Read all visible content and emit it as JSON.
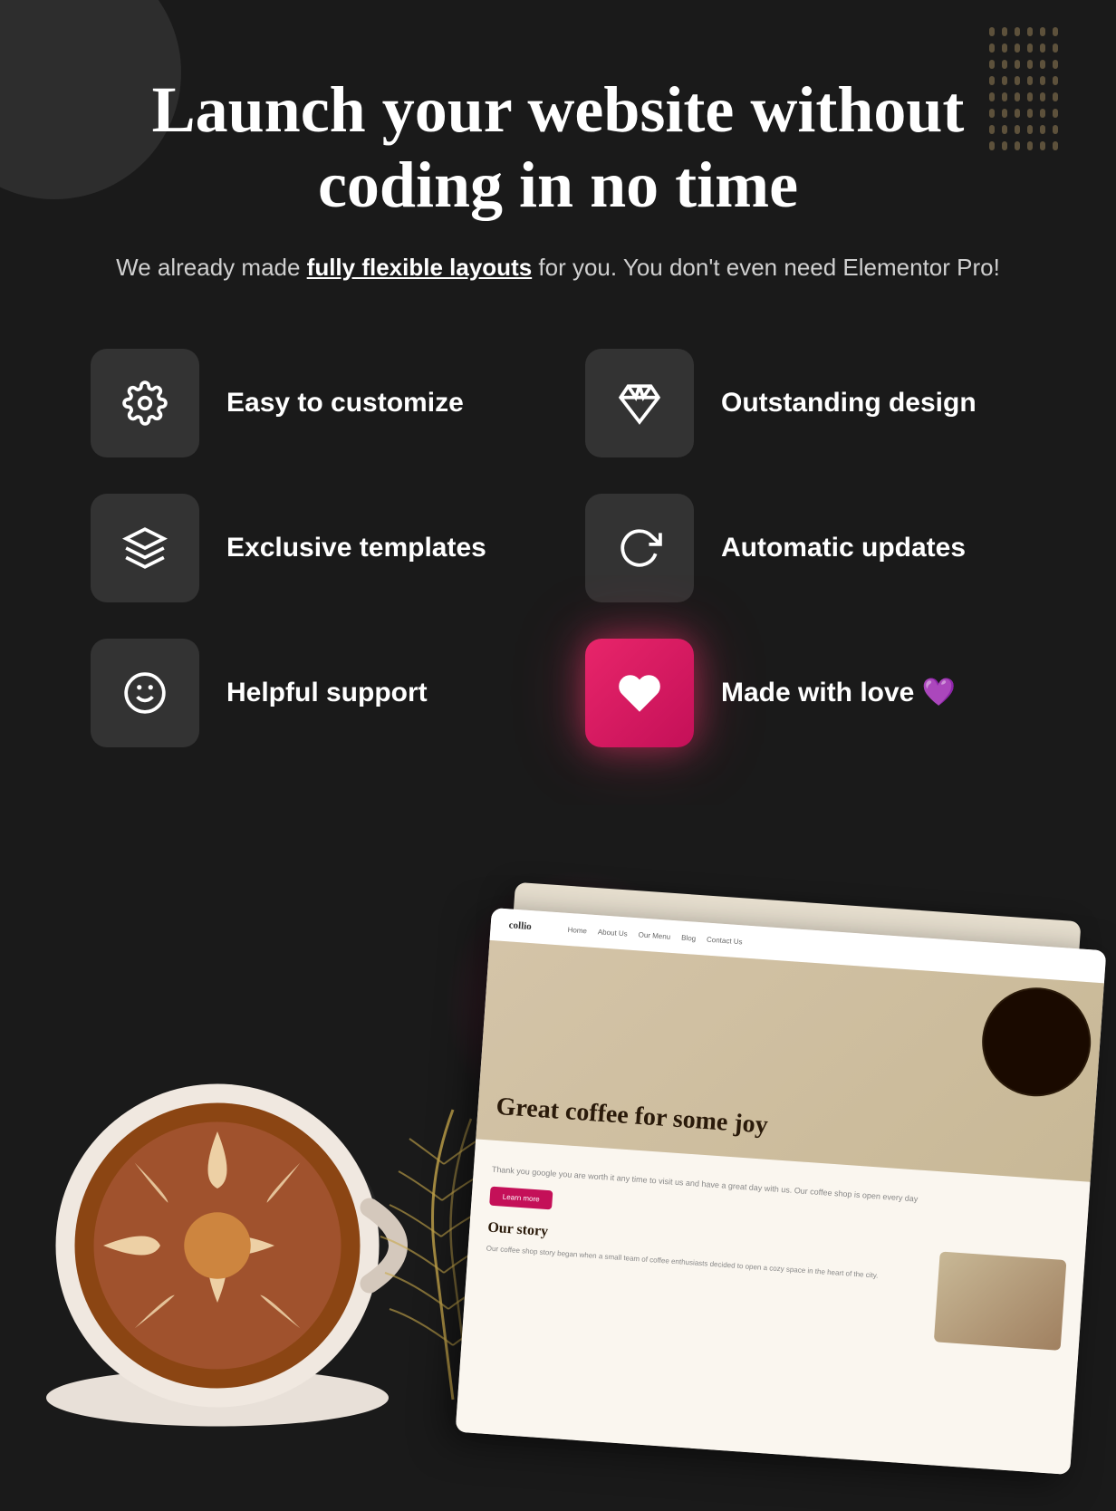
{
  "background": {
    "color": "#1a1a1a"
  },
  "hero": {
    "title": "Launch your website without coding in no time",
    "subtitle_prefix": "We already made ",
    "subtitle_bold": "fully flexible layouts",
    "subtitle_suffix": " for you. You don't even need Elementor Pro!"
  },
  "features": [
    {
      "id": "easy-customize",
      "icon": "gear",
      "label": "Easy to customize",
      "icon_style": "dark"
    },
    {
      "id": "outstanding-design",
      "icon": "diamond",
      "label": "Outstanding design",
      "icon_style": "dark"
    },
    {
      "id": "exclusive-templates",
      "icon": "layers",
      "label": "Exclusive templates",
      "icon_style": "dark"
    },
    {
      "id": "automatic-updates",
      "icon": "refresh",
      "label": "Automatic updates",
      "icon_style": "dark"
    },
    {
      "id": "helpful-support",
      "icon": "smile",
      "label": "Helpful support",
      "icon_style": "dark"
    },
    {
      "id": "made-with-love",
      "icon": "heart",
      "label": "Made with love 💜",
      "icon_style": "pink"
    }
  ],
  "mockup": {
    "title": "Great coffee for some joy",
    "body_text": "Thank you google you are worth it any time to visit us and have a great day with us. Our coffee shop is open every day",
    "button_label": "Learn more",
    "section_title": "Our story",
    "section_text": "Our coffee shop story began when a small team of coffee enthusiasts decided to open a cozy space in the heart of the city."
  }
}
